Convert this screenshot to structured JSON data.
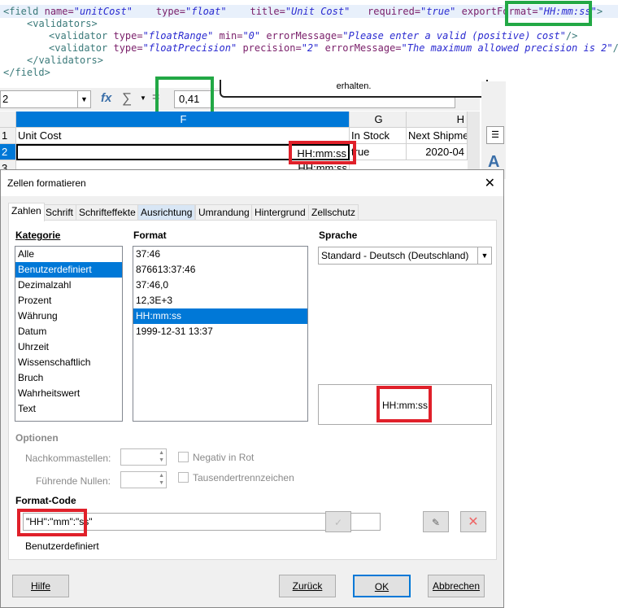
{
  "xml": {
    "line1": {
      "tag_open": "<field",
      "name_attr": "name=",
      "name_val": "\"unitCost\"",
      "type_attr": "type=",
      "type_val": "\"float\"",
      "title_attr": "title=",
      "title_val": "\"Unit Cost\"",
      "req_attr": "required=",
      "req_val": "\"true\"",
      "exp_attr": "exportFormat=",
      "exp_val": "\"HH:mm:ss\"",
      "close": ">"
    },
    "line2": "<validators>",
    "line3": {
      "tag": "<validator",
      "type_attr": "type=",
      "type_val": "\"floatRange\"",
      "min_attr": "min=",
      "min_val": "\"0\"",
      "err_attr": "errorMessage=",
      "err_val": "\"Please enter a valid (positive) cost\"",
      "close": "/>"
    },
    "line4": {
      "tag": "<validator",
      "type_attr": "type=",
      "type_val": "\"floatPrecision\"",
      "prec_attr": "precision=",
      "prec_val": "\"2\"",
      "err_attr": "errorMessage=",
      "err_val": "\"The maximum allowed precision is 2\"",
      "close": "/>"
    },
    "line5": "</validators>",
    "line6": "</field>"
  },
  "tooltip": "erhalten.",
  "formula_bar": {
    "name_box": "2",
    "fx": "fx",
    "sigma": "∑",
    "equals": "=",
    "value": "0,41"
  },
  "sheet": {
    "columns": [
      "F",
      "G",
      "H"
    ],
    "rows": [
      {
        "num": "1",
        "F": "Unit Cost",
        "G": "In Stock",
        "H": "Next Shipme"
      },
      {
        "num": "2",
        "F": "HH:mm:ss",
        "G": "true",
        "H": "2020-04"
      },
      {
        "num": "3",
        "F": "HH:mm:ss",
        "G": "",
        "H": ""
      }
    ]
  },
  "dialog": {
    "title": "Zellen formatieren",
    "close": "✕",
    "tabs": [
      "Zahlen",
      "Schrift",
      "Schrifteffekte",
      "Ausrichtung",
      "Umrandung",
      "Hintergrund",
      "Zellschutz"
    ],
    "active_tab": "Zahlen",
    "kategorie_label": "Kategorie",
    "kategorie": [
      "Alle",
      "Benutzerdefiniert",
      "Dezimalzahl",
      "Prozent",
      "Währung",
      "Datum",
      "Uhrzeit",
      "Wissenschaftlich",
      "Bruch",
      "Wahrheitswert",
      "Text"
    ],
    "kategorie_selected": "Benutzerdefiniert",
    "format_label": "Format",
    "formats": [
      "37:46",
      "876613:37:46",
      "37:46,0",
      "12,3E+3",
      "HH:mm:ss",
      "1999-12-31 13:37"
    ],
    "format_selected": "HH:mm:ss",
    "sprache_label": "Sprache",
    "sprache_value": "Standard - Deutsch (Deutschland)",
    "preview": "HH:mm:ss",
    "optionen_label": "Optionen",
    "nachkomma_label": "Nachkommastellen:",
    "nullen_label": "Führende Nullen:",
    "negativ_label": "Negativ in Rot",
    "tausender_label": "Tausendertrennzeichen",
    "format_code_label": "Format-Code",
    "format_code_value": "\"HH\":\"mm\":\"ss\"",
    "format_code_desc": "Benutzerdefiniert",
    "buttons": {
      "help": "Hilfe",
      "back": "Zurück",
      "ok": "OK",
      "cancel": "Abbrechen"
    }
  }
}
